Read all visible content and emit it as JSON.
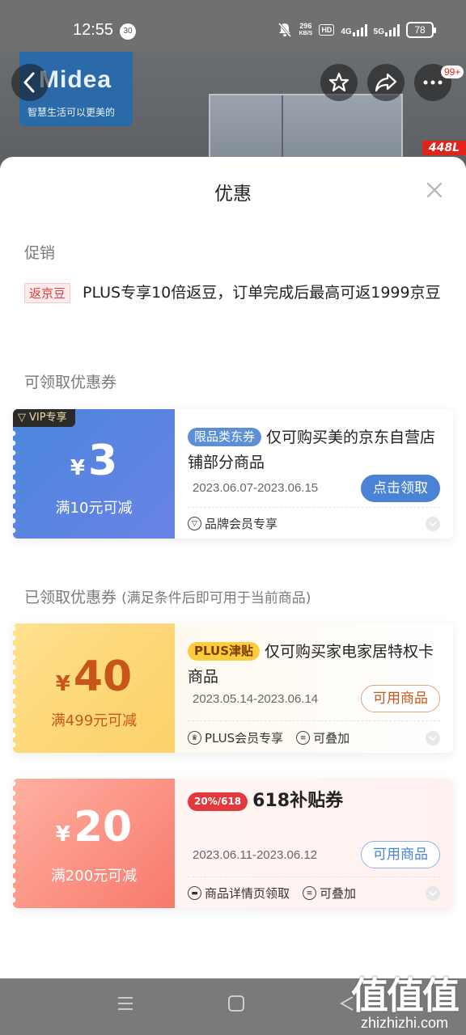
{
  "status_bar": {
    "time": "12:55",
    "notification_count": "30",
    "speed_value": "296",
    "speed_unit": "KB/S",
    "hd": "HD",
    "net1": "4G",
    "net2": "5G",
    "battery": "78"
  },
  "product": {
    "brand": "Midea",
    "brand_slogan": "智慧生活可以更美的",
    "capacity": "448L",
    "cart_count": "99+"
  },
  "sheet": {
    "title": "优惠",
    "promotion": {
      "section_label": "促销",
      "tag": "返京豆",
      "text": "PLUS专享10倍返豆，订单完成后最高可返1999京豆"
    },
    "available": {
      "section_label": "可领取优惠券",
      "coupons": [
        {
          "badge": "VIP专享",
          "currency": "¥",
          "amount": "3",
          "condition": "满10元可减",
          "pill": "限品类东券",
          "title": "仅可购买美的京东自营店铺部分商品",
          "date": "2023.06.07-2023.06.15",
          "button": "点击领取",
          "features": [
            "品牌会员专享"
          ]
        }
      ]
    },
    "received": {
      "section_label": "已领取优惠券",
      "note": "(满足条件后即可用于当前商品)",
      "coupons": [
        {
          "currency": "¥",
          "amount": "40",
          "condition": "满499元可减",
          "pill": "PLUS津贴",
          "title": "仅可购买家电家居特权卡商品",
          "date": "2023.05.14-2023.06.14",
          "button": "可用商品",
          "features": [
            "PLUS会员专享",
            "可叠加"
          ]
        },
        {
          "currency": "¥",
          "amount": "20",
          "condition": "满200元可减",
          "pill": "20%/618",
          "title": "618补贴券",
          "date": "2023.06.11-2023.06.12",
          "button": "可用商品",
          "features": [
            "商品详情页领取",
            "可叠加"
          ]
        }
      ]
    }
  },
  "watermark": {
    "big": "值值值",
    "small": "zhizhizhi.com"
  },
  "colors": {
    "blue_button": "#4a82d6",
    "vip_gradient_start": "#4b86dc",
    "vip_gradient_end": "#6a83e6",
    "plus_gradient_start": "#ffd87a",
    "plus_amount": "#c8561b",
    "red_gradient_start": "#ff9a8a",
    "red_tag": "#e4393c"
  }
}
